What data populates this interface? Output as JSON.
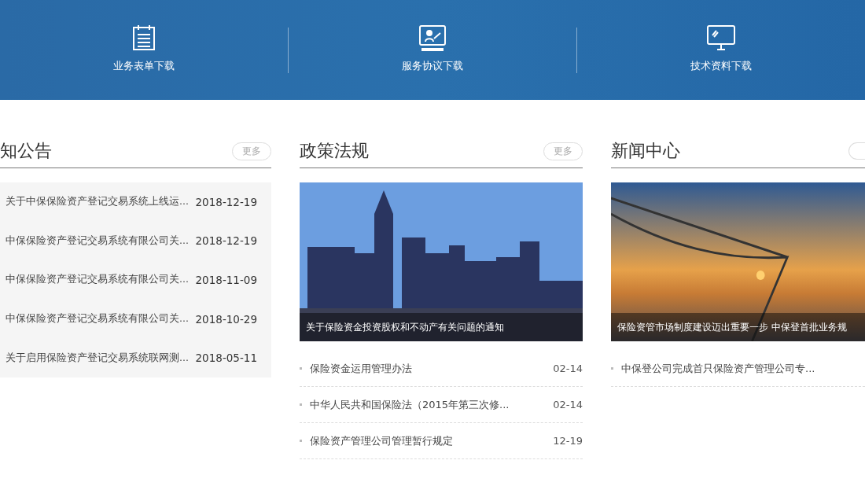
{
  "banner": {
    "links": [
      {
        "kind": "form",
        "label": "业务表单下载"
      },
      {
        "kind": "teacher",
        "label": "服务协议下载"
      },
      {
        "kind": "monitor",
        "label": "技术资料下载"
      }
    ]
  },
  "sections": [
    {
      "title": "知公告",
      "more": "更多",
      "items": [
        {
          "title": "关于中保保险资产登记交易系统上线运...",
          "date": "2018-12-19"
        },
        {
          "title": "中保保险资产登记交易系统有限公司关...",
          "date": "2018-12-19"
        },
        {
          "title": "中保保险资产登记交易系统有限公司关...",
          "date": "2018-11-09"
        },
        {
          "title": "中保保险资产登记交易系统有限公司关...",
          "date": "2018-10-29"
        },
        {
          "title": "关于启用保险资产登记交易系统联网测...",
          "date": "2018-05-11"
        }
      ]
    },
    {
      "title": "政策法规",
      "more": "更多",
      "feature": {
        "kind": "city",
        "caption": "关于保险资金投资股权和不动产有关问题的通知"
      },
      "items": [
        {
          "title": "保险资金运用管理办法",
          "date": "02-14"
        },
        {
          "title": "中华人民共和国保险法（2015年第三次修...",
          "date": "02-14"
        },
        {
          "title": "保险资产管理公司管理暂行规定",
          "date": "12-19"
        }
      ]
    },
    {
      "title": "新闻中心",
      "feature": {
        "kind": "sunset",
        "caption": "保险资管市场制度建设迈出重要一步 中保登首批业务规"
      },
      "items": [
        {
          "title": "中保登公司完成首只保险资产管理公司专..."
        }
      ]
    }
  ]
}
